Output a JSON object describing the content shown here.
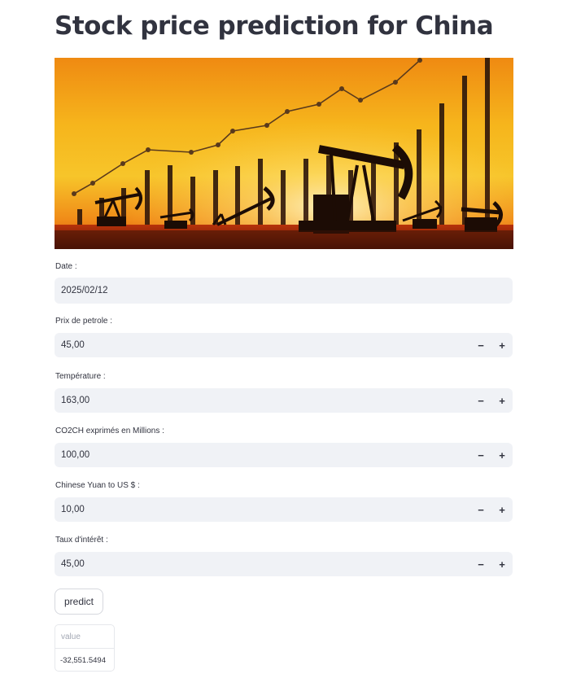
{
  "page": {
    "title": "Stock price prediction for China"
  },
  "hero_image": {
    "description_icon": "oil-pumpjack-sunset-chart-image"
  },
  "form": {
    "date": {
      "label": "Date :",
      "value": "2025/02/12"
    },
    "prix_petrole": {
      "label": "Prix de petrole :",
      "value": "45,00",
      "minus": "−",
      "plus": "+"
    },
    "temperature": {
      "label": "Température :",
      "value": "163,00",
      "minus": "−",
      "plus": "+"
    },
    "co2": {
      "label": "CO2CH exprimés en Millions :",
      "value": "100,00",
      "minus": "−",
      "plus": "+"
    },
    "yuan_usd": {
      "label": "Chinese Yuan to US $ :",
      "value": "10,00",
      "minus": "−",
      "plus": "+"
    },
    "taux": {
      "label": "Taux d'intérêt :",
      "value": "45,00",
      "minus": "−",
      "plus": "+"
    }
  },
  "predict_button": {
    "label": "predict"
  },
  "result": {
    "header": "value",
    "value": "-32,551.5494"
  },
  "colors": {
    "accent_text": "#31333f",
    "input_bg": "#f0f2f6"
  }
}
